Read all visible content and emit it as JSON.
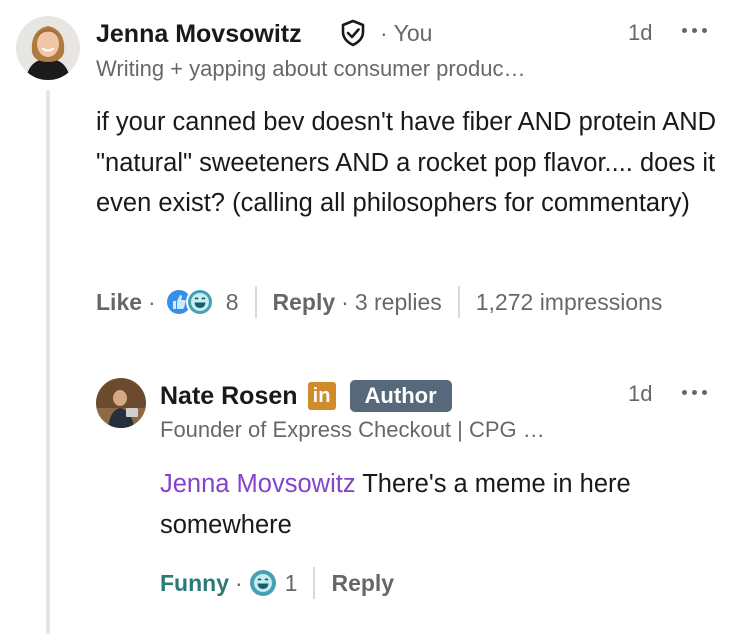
{
  "comment": {
    "author_name": "Jenna Movsowitz",
    "you_label": "You",
    "headline": "Writing + yapping about consumer produc…",
    "time": "1d",
    "text": "if your canned bev doesn't have fiber AND protein AND \"natural\" sweeteners AND a rocket pop flavor.... does it even exist? (calling all philosophers for commentary)",
    "like_label": "Like",
    "reaction_count": "8",
    "reply_label": "Reply",
    "replies_count": "3 replies",
    "impressions": "1,272 impressions"
  },
  "reply": {
    "author_name": "Nate Rosen",
    "linkedin_badge": "in",
    "author_badge": "Author",
    "headline": "Founder of Express Checkout | CPG …",
    "time": "1d",
    "mention": "Jenna Movsowitz",
    "text": " There's a meme in here somewhere",
    "reaction_label": "Funny",
    "reaction_count": "1",
    "reply_label": "Reply"
  },
  "colors": {
    "mention": "#8344cc",
    "funny": "#2b7a78",
    "author_badge_bg": "#56687a",
    "linkedin_badge_bg": "#d08c2b",
    "thread_line": "#eae6df"
  },
  "icons": {
    "verified": "shield-check-icon",
    "more": "more-options-icon",
    "like_reaction": "thumbs-up-reaction-icon",
    "funny_reaction": "laughing-face-reaction-icon"
  }
}
